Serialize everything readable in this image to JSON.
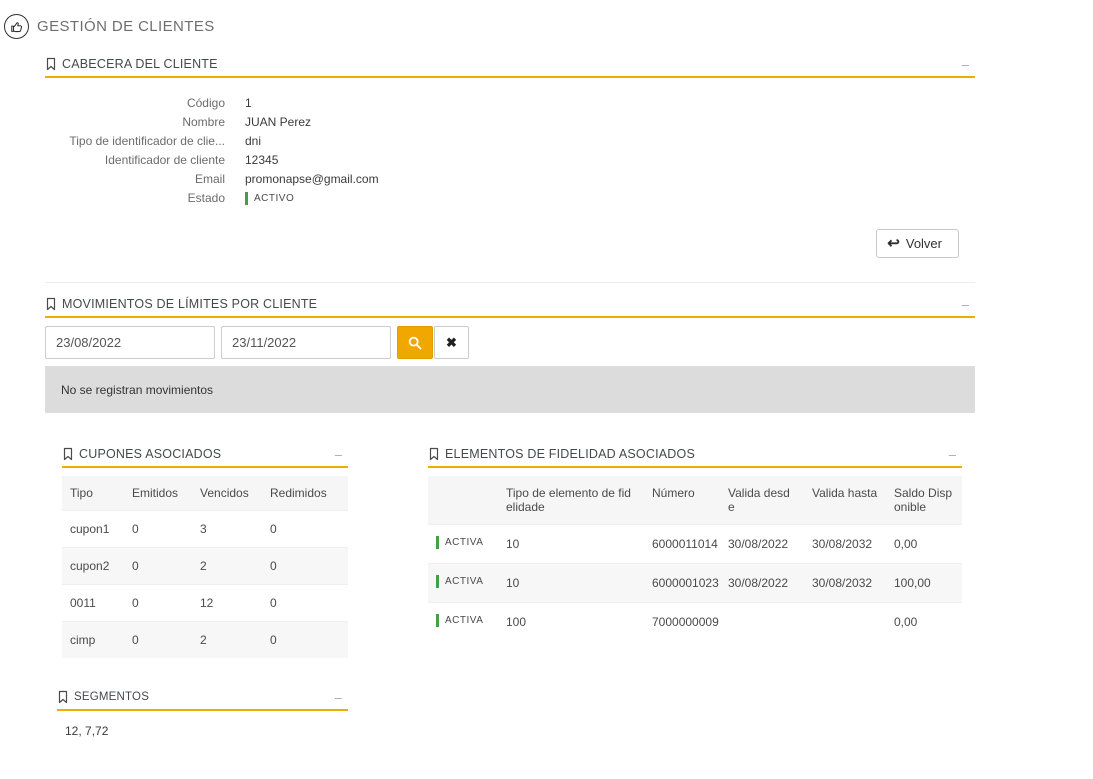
{
  "colors": {
    "accent": "#f0ad00",
    "button_accent": "#f0a800",
    "status_green": "#43a047",
    "empty_box_gray": "#dcdcdc"
  },
  "icons": {
    "collapse": "–",
    "clear": "✖",
    "volver_arrow": "↩"
  },
  "page": {
    "title": "GESTIÓN DE CLIENTES"
  },
  "cabecera": {
    "title": "CABECERA DEL CLIENTE",
    "fields": [
      {
        "label": "Código",
        "value": "1"
      },
      {
        "label": "Nombre",
        "value": "JUAN Perez"
      },
      {
        "label": "Tipo de identificador de clie...",
        "value": "dni"
      },
      {
        "label": "Identificador de cliente",
        "value": "12345"
      },
      {
        "label": "Email",
        "value": "promonapse@gmail.com"
      }
    ],
    "estado": {
      "label": "Estado",
      "value": "ACTIVO"
    },
    "volver_label": "Volver"
  },
  "movimientos": {
    "title": "MOVIMIENTOS DE LÍMITES POR CLIENTE",
    "date_from": "23/08/2022",
    "date_to": "23/11/2022",
    "empty_message": "No se registran movimientos"
  },
  "cupones": {
    "title": "CUPONES ASOCIADOS",
    "columns": [
      "Tipo",
      "Emitidos",
      "Vencidos",
      "Redimidos"
    ],
    "rows": [
      [
        "cupon1",
        "0",
        "3",
        "0"
      ],
      [
        "cupon2",
        "0",
        "2",
        "0"
      ],
      [
        "0011",
        "0",
        "12",
        "0"
      ],
      [
        "cimp",
        "0",
        "2",
        "0"
      ]
    ]
  },
  "fidelidad": {
    "title": "ELEMENTOS DE FIDELIDAD ASOCIADOS",
    "columns": [
      "",
      "Tipo de elemento de fidelidade",
      "Número",
      "Valida desde",
      "Valida hasta",
      "Saldo Disponible"
    ],
    "rows": [
      {
        "estado": "ACTIVA",
        "tipo": "10",
        "numero": "6000011014",
        "desde": "30/08/2022",
        "hasta": "30/08/2032",
        "saldo": "0,00"
      },
      {
        "estado": "ACTIVA",
        "tipo": "10",
        "numero": "6000001023",
        "desde": "30/08/2022",
        "hasta": "30/08/2032",
        "saldo": "100,00"
      },
      {
        "estado": "ACTIVA",
        "tipo": "100",
        "numero": "7000000009",
        "desde": "",
        "hasta": "",
        "saldo": "0,00"
      }
    ]
  },
  "segmentos": {
    "title": "SEGMENTOS",
    "value": "12, 7,72"
  }
}
